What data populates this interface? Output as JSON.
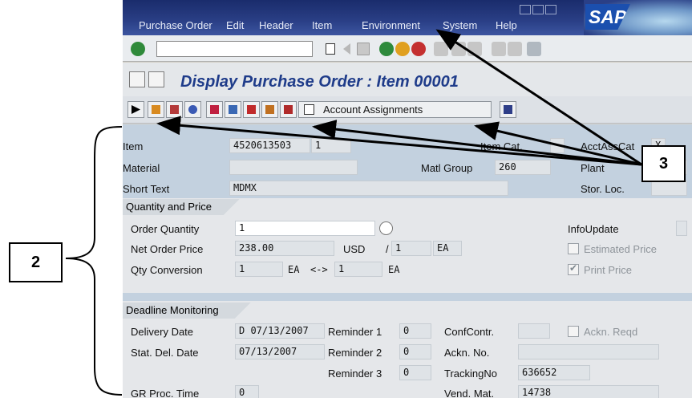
{
  "menu": {
    "items": [
      {
        "label": "Purchase Order",
        "key": "u"
      },
      {
        "label": "Edit",
        "key": "E"
      },
      {
        "label": "Header",
        "key": "a"
      },
      {
        "label": "Item",
        "key": "I"
      },
      {
        "label": "Environment",
        "key": "v"
      },
      {
        "label": "System",
        "key": "S"
      },
      {
        "label": "Help",
        "key": "H"
      }
    ],
    "logo": "SAP"
  },
  "title": "Display Purchase Order : Item 00001",
  "toolbar": {
    "account_assignments_label": "Account Assignments"
  },
  "header": {
    "item_label": "Item",
    "item_po": "4520613503",
    "item_no": "1",
    "item_cat_label": "Item Cat.",
    "acct_assg_cat_label": "AcctAssCat",
    "acct_assg_cat_value": "X",
    "material_label": "Material",
    "matl_group_label": "Matl Group",
    "matl_group_value": "260",
    "plant_label": "Plant",
    "short_text_label": "Short Text",
    "short_text_value": "MDMX",
    "stor_loc_label": "Stor. Loc."
  },
  "quantity": {
    "section_title": "Quantity and Price",
    "order_qty_label": "Order Quantity",
    "order_qty_value": "1",
    "info_update_label": "InfoUpdate",
    "net_price_label": "Net Order Price",
    "net_price_value": "238.00",
    "currency": "USD",
    "per_sep": "/",
    "per_qty": "1",
    "per_unit": "EA",
    "estimated_price_label": "Estimated Price",
    "qty_conv_label": "Qty Conversion",
    "conv_qty1": "1",
    "conv_unit1": "EA",
    "conv_arrow": "<->",
    "conv_qty2": "1",
    "conv_unit2": "EA",
    "print_price_label": "Print Price"
  },
  "deadline": {
    "section_title": "Deadline Monitoring",
    "delivery_date_label": "Delivery Date",
    "delivery_date_value": "D 07/13/2007",
    "reminder1_label": "Reminder 1",
    "reminder1_value": "0",
    "conf_contr_label": "ConfContr.",
    "ackn_reqd_label": "Ackn. Reqd",
    "stat_del_date_label": "Stat. Del. Date",
    "stat_del_date_value": "07/13/2007",
    "reminder2_label": "Reminder 2",
    "reminder2_value": "0",
    "ackn_no_label": "Ackn. No.",
    "reminder3_label": "Reminder 3",
    "reminder3_value": "0",
    "tracking_no_label": "TrackingNo",
    "tracking_no_value": "636652",
    "gr_proc_time_label": "GR Proc. Time",
    "gr_proc_time_value": "0",
    "vend_mat_label": "Vend. Mat.",
    "vend_mat_value": "14738"
  },
  "annotations": {
    "label_2": "2",
    "label_3": "3"
  },
  "colors": {
    "menubar": "#2a3f86",
    "title": "#1f3c8a",
    "header_band": "#c3d1df"
  },
  "icons": [
    "enter-icon",
    "command-field-icon",
    "save-icon",
    "back-icon",
    "exit-icon",
    "cancel-icon",
    "print-icon",
    "find-icon",
    "create-session-icon",
    "layout-icon"
  ]
}
